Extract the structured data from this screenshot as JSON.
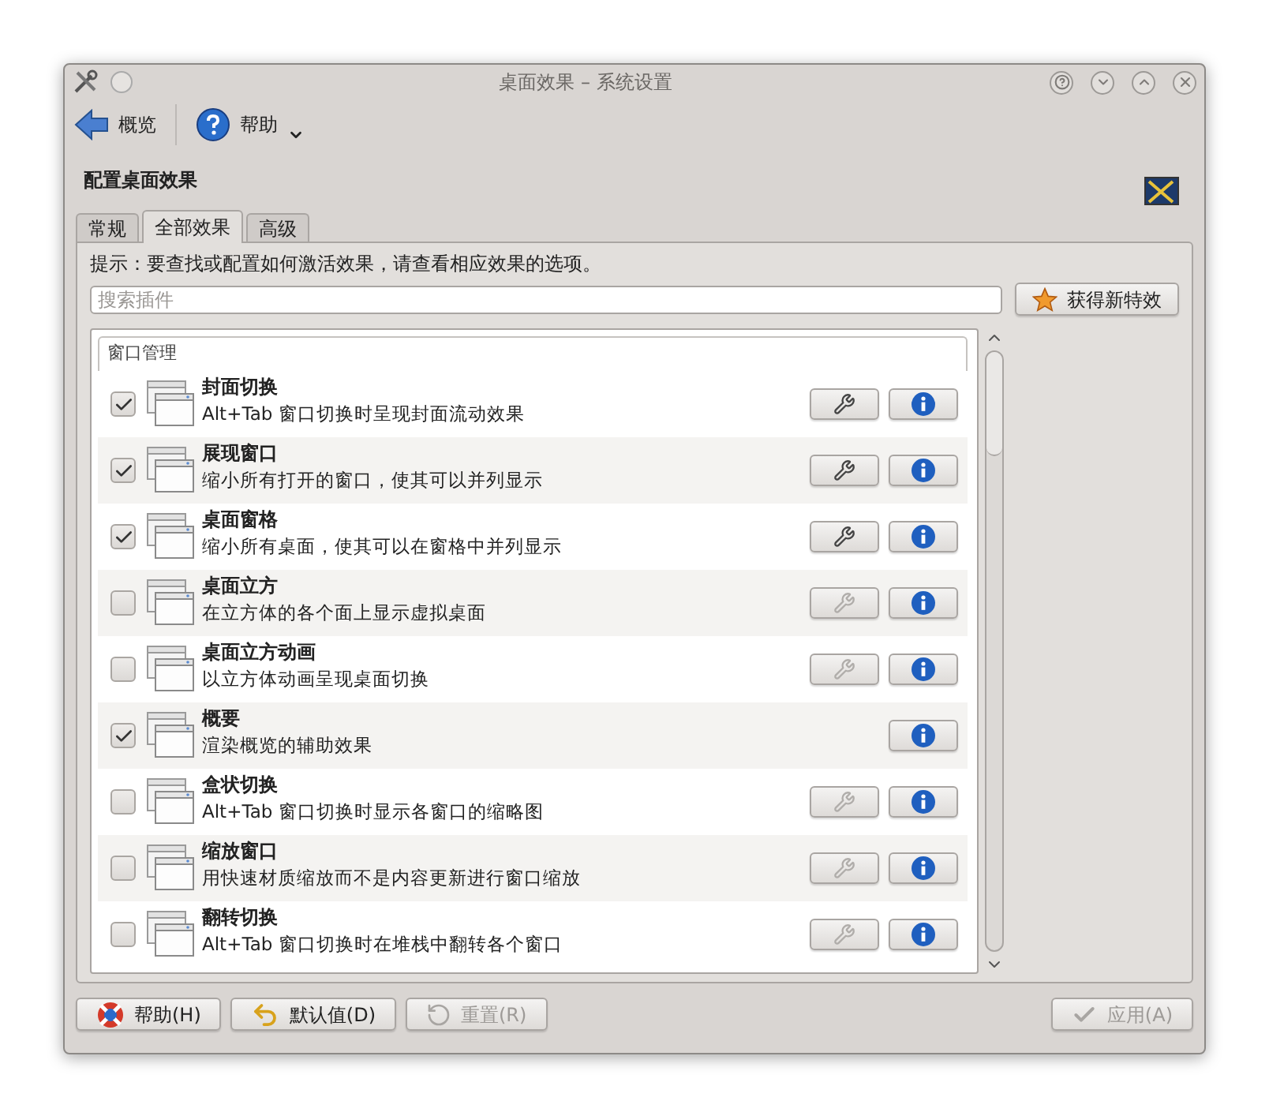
{
  "window": {
    "title": "桌面效果 – 系统设置"
  },
  "toolbar": [
    {
      "kind": "back",
      "label": "概览"
    },
    {
      "kind": "help",
      "label": "帮助"
    }
  ],
  "heading": "配置桌面效果",
  "tabs": [
    {
      "label": "常规",
      "selected": false
    },
    {
      "label": "全部效果",
      "selected": true
    },
    {
      "label": "高级",
      "selected": false
    }
  ],
  "hint": "提示：要查找或配置如何激活效果，请查看相应效果的选项。",
  "search": {
    "placeholder": "搜索插件"
  },
  "get_new_button": "获得新特效",
  "group": {
    "title": "窗口管理",
    "effects": [
      {
        "name": "封面切换",
        "description": "Alt+Tab 窗口切换时呈现封面流动效果",
        "checked": true,
        "configurable": true
      },
      {
        "name": "展现窗口",
        "description": "缩小所有打开的窗口，使其可以并列显示",
        "checked": true,
        "configurable": true
      },
      {
        "name": "桌面窗格",
        "description": "缩小所有桌面，使其可以在窗格中并列显示",
        "checked": true,
        "configurable": true
      },
      {
        "name": "桌面立方",
        "description": "在立方体的各个面上显示虚拟桌面",
        "checked": false,
        "configurable": true
      },
      {
        "name": "桌面立方动画",
        "description": "以立方体动画呈现桌面切换",
        "checked": false,
        "configurable": true
      },
      {
        "name": "概要",
        "description": "渲染概览的辅助效果",
        "checked": true,
        "configurable": false
      },
      {
        "name": "盒状切换",
        "description": "Alt+Tab 窗口切换时显示各窗口的缩略图",
        "checked": false,
        "configurable": true
      },
      {
        "name": "缩放窗口",
        "description": "用快速材质缩放而不是内容更新进行窗口缩放",
        "checked": false,
        "configurable": true
      },
      {
        "name": "翻转切换",
        "description": "Alt+Tab 窗口切换时在堆栈中翻转各个窗口",
        "checked": false,
        "configurable": true
      }
    ]
  },
  "footer_buttons": [
    {
      "kind": "help",
      "label": "帮助(H)",
      "disabled": false
    },
    {
      "kind": "defaults",
      "label": "默认值(D)",
      "disabled": false
    },
    {
      "kind": "reset",
      "label": "重置(R)",
      "disabled": true
    },
    {
      "kind": "apply",
      "label": "应用(A)",
      "disabled": true
    }
  ]
}
